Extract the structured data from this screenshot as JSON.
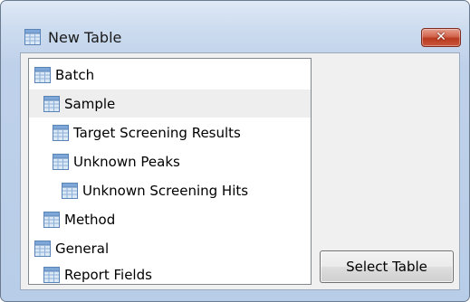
{
  "window": {
    "title": "New Table",
    "close_glyph": "✕",
    "title_icon": "table-icon",
    "close_color": "#c9573c"
  },
  "tree": {
    "items": [
      {
        "label": "Batch",
        "icon": "table-icon",
        "level": 0,
        "selected": false
      },
      {
        "label": "Sample",
        "icon": "table-icon",
        "level": 1,
        "selected": true
      },
      {
        "label": "Target Screening Results",
        "icon": "table-icon",
        "level": 2,
        "selected": false
      },
      {
        "label": "Unknown Peaks",
        "icon": "table-icon",
        "level": 2,
        "selected": false
      },
      {
        "label": "Unknown Screening Hits",
        "icon": "table-icon",
        "level": 3,
        "selected": false
      },
      {
        "label": "Method",
        "icon": "table-icon",
        "level": 1,
        "selected": false
      },
      {
        "label": "General",
        "icon": "table-icon",
        "level": 0,
        "selected": false
      },
      {
        "label": "Report Fields",
        "icon": "table-icon",
        "level": 1,
        "selected": false
      }
    ],
    "selection_color": "#eeeeee"
  },
  "actions": {
    "select_table_label": "Select Table"
  }
}
